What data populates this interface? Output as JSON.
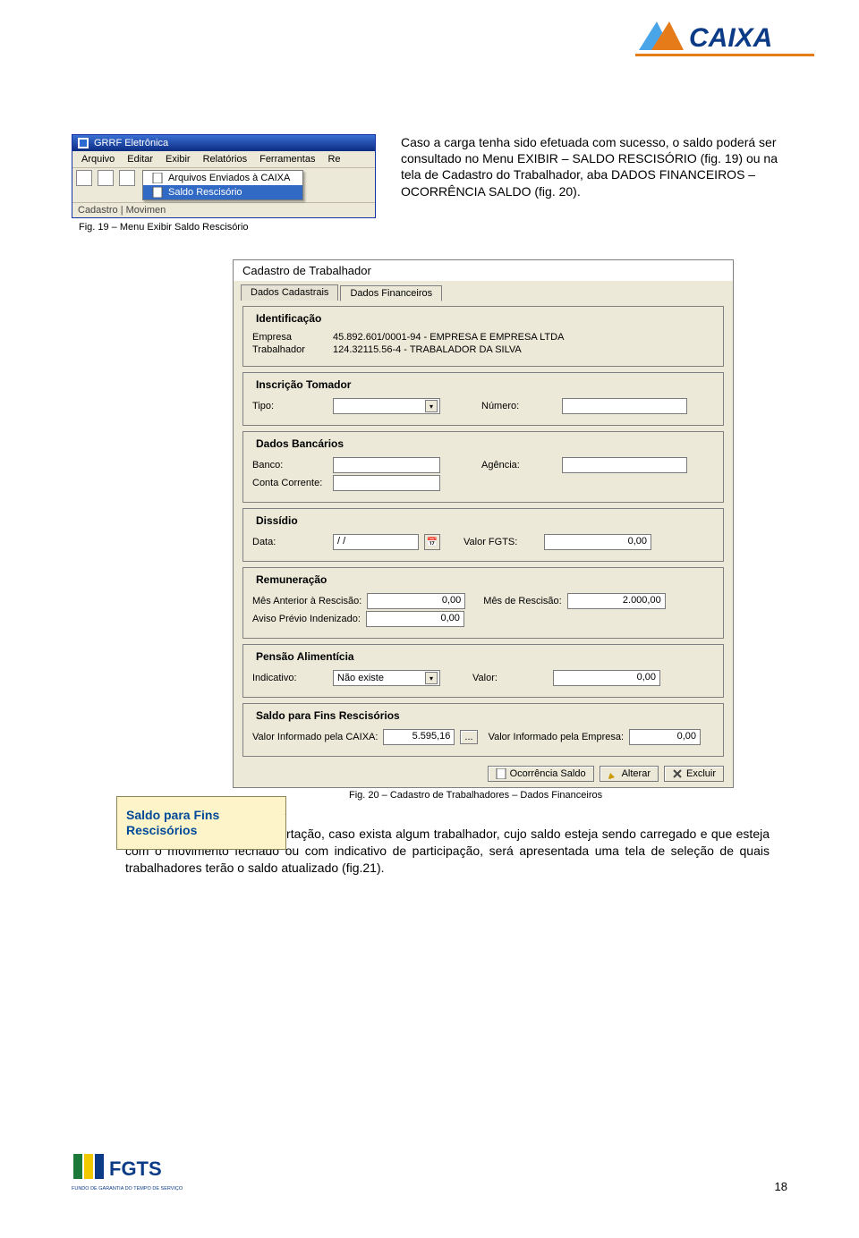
{
  "logos": {
    "caixa": "CAIXA",
    "fgts": "FGTS",
    "fgts_sub": "FUNDO DE GARANTIA DO TEMPO DE SERVIÇO"
  },
  "page_number": "18",
  "screenshot1": {
    "title": "GRRF Eletrônica",
    "menu": [
      "Arquivo",
      "Editar",
      "Exibir",
      "Relatórios",
      "Ferramentas",
      "Re"
    ],
    "submenu": {
      "items": [
        "Arquivos Enviados à CAIXA",
        "Saldo Rescisório"
      ],
      "highlighted_index": 1
    },
    "status": "Cadastro  | Movimen"
  },
  "caption1": "Fig. 19 – Menu Exibir Saldo Rescisório",
  "paragraph1": "Caso a carga tenha sido efetuada com sucesso, o saldo poderá ser consultado no Menu EXIBIR – SALDO RESCISÓRIO (fig. 19) ou na tela de Cadastro do Trabalhador, aba DADOS FINANCEIROS – OCORRÊNCIA SALDO (fig. 20).",
  "screenshot2": {
    "window_title": "Cadastro de Trabalhador",
    "tabs": {
      "inactive": "Dados Cadastrais",
      "active": "Dados Financeiros"
    },
    "ident": {
      "legend": "Identificação",
      "empresa_label": "Empresa",
      "empresa_value": "45.892.601/0001-94 - EMPRESA E EMPRESA LTDA",
      "trab_label": "Trabalhador",
      "trab_value": "124.32115.56-4 - TRABALADOR DA SILVA"
    },
    "tomador": {
      "legend": "Inscrição Tomador",
      "tipo_label": "Tipo:",
      "tipo_value": "",
      "numero_label": "Número:",
      "numero_value": ""
    },
    "bancarios": {
      "legend": "Dados Bancários",
      "banco_label": "Banco:",
      "banco_value": "",
      "agencia_label": "Agência:",
      "agencia_value": "",
      "conta_label": "Conta Corrente:",
      "conta_value": ""
    },
    "dissidio": {
      "legend": "Dissídio",
      "data_label": "Data:",
      "data_value": "  /  /",
      "valor_label": "Valor FGTS:",
      "valor_value": "0,00"
    },
    "remun": {
      "legend": "Remuneração",
      "mes_ant_label": "Mês Anterior à Rescisão:",
      "mes_ant_value": "0,00",
      "mes_resc_label": "Mês de Rescisão:",
      "mes_resc_value": "2.000,00",
      "aviso_label": "Aviso Prévio Indenizado:",
      "aviso_value": "0,00"
    },
    "pensao": {
      "legend": "Pensão Alimentícia",
      "ind_label": "Indicativo:",
      "ind_value": "Não existe",
      "valor_label": "Valor:",
      "valor_value": "0,00"
    },
    "saldo": {
      "legend": "Saldo para Fins Rescisórios",
      "caixa_label": "Valor Informado pela CAIXA:",
      "caixa_value": "5.595,16",
      "caixa_extra": "...",
      "empresa_label": "Valor Informado pela Empresa:",
      "empresa_value": "0,00"
    },
    "buttons": {
      "ocorrencia": "Ocorrência Saldo",
      "alterar": "Alterar",
      "excluir": "Excluir"
    }
  },
  "callout": "Saldo para Fins Rescisórios",
  "caption2": "Fig. 20 – Cadastro de Trabalhadores – Dados Financeiros",
  "paragraph2": "Após realizada a importação, caso exista algum trabalhador, cujo saldo esteja sendo carregado e que esteja com o movimento fechado ou com indicativo de participação, será apresentada uma tela de seleção de quais trabalhadores terão o saldo atualizado (fig.21)."
}
